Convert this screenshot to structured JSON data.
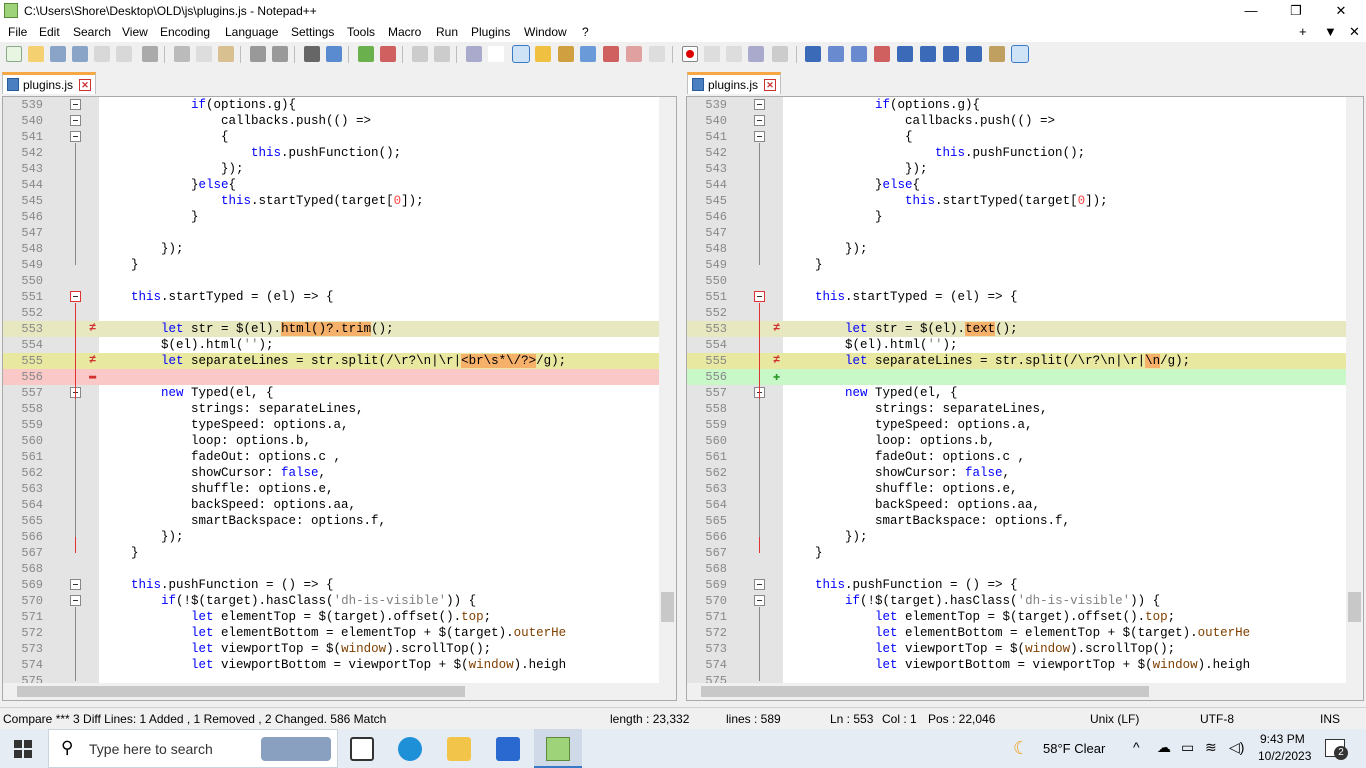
{
  "window": {
    "title": "C:\\Users\\Shore\\Desktop\\OLD\\js\\plugins.js - Notepad++"
  },
  "menu": [
    "File",
    "Edit",
    "Search",
    "View",
    "Encoding",
    "Language",
    "Settings",
    "Tools",
    "Macro",
    "Run",
    "Plugins",
    "Window",
    "?"
  ],
  "menu_right": [
    "+",
    "▼",
    "✕"
  ],
  "tabs": {
    "left": {
      "name": "plugins.js"
    },
    "right": {
      "name": "plugins.js"
    }
  },
  "left_lines": [
    {
      "n": "539",
      "t": "            if(options.g){"
    },
    {
      "n": "540",
      "t": "                callbacks.push(() =>"
    },
    {
      "n": "541",
      "t": "                {"
    },
    {
      "n": "542",
      "t": "                    this.pushFunction();"
    },
    {
      "n": "543",
      "t": "                });"
    },
    {
      "n": "544",
      "t": "            }else{"
    },
    {
      "n": "545",
      "t": "                this.startTyped(target[0]);"
    },
    {
      "n": "546",
      "t": "            }"
    },
    {
      "n": "547",
      "t": ""
    },
    {
      "n": "548",
      "t": "        });"
    },
    {
      "n": "549",
      "t": "    }"
    },
    {
      "n": "550",
      "t": ""
    },
    {
      "n": "551",
      "t": "    this.startTyped = (el) => {"
    },
    {
      "n": "552",
      "t": ""
    },
    {
      "n": "553",
      "t": "        let str = $(el).html()?.trim();"
    },
    {
      "n": "554",
      "t": "        $(el).html('');"
    },
    {
      "n": "555",
      "t": "        let separateLines = str.split(/\\r?\\n|\\r|<br\\s*\\/?>/g);"
    },
    {
      "n": "556",
      "t": ""
    },
    {
      "n": "557",
      "t": "        new Typed(el, {"
    },
    {
      "n": "558",
      "t": "            strings: separateLines,"
    },
    {
      "n": "559",
      "t": "            typeSpeed: options.a,"
    },
    {
      "n": "560",
      "t": "            loop: options.b,"
    },
    {
      "n": "561",
      "t": "            fadeOut: options.c ,"
    },
    {
      "n": "562",
      "t": "            showCursor: false,"
    },
    {
      "n": "563",
      "t": "            shuffle: options.e,"
    },
    {
      "n": "564",
      "t": "            backSpeed: options.aa,"
    },
    {
      "n": "565",
      "t": "            smartBackspace: options.f,"
    },
    {
      "n": "566",
      "t": "        });"
    },
    {
      "n": "567",
      "t": "    }"
    },
    {
      "n": "568",
      "t": ""
    },
    {
      "n": "569",
      "t": "    this.pushFunction = () => {"
    },
    {
      "n": "570",
      "t": "        if(!$(target).hasClass('dh-is-visible')) {"
    },
    {
      "n": "571",
      "t": "            let elementTop = $(target).offset().top;"
    },
    {
      "n": "572",
      "t": "            let elementBottom = elementTop + $(target).outerHe"
    },
    {
      "n": "573",
      "t": "            let viewportTop = $(window).scrollTop();"
    },
    {
      "n": "574",
      "t": "            let viewportBottom = viewportTop + $(window).heigh"
    },
    {
      "n": "575",
      "t": ""
    }
  ],
  "right_lines": [
    {
      "n": "539",
      "t": "            if(options.g){"
    },
    {
      "n": "540",
      "t": "                callbacks.push(() =>"
    },
    {
      "n": "541",
      "t": "                {"
    },
    {
      "n": "542",
      "t": "                    this.pushFunction();"
    },
    {
      "n": "543",
      "t": "                });"
    },
    {
      "n": "544",
      "t": "            }else{"
    },
    {
      "n": "545",
      "t": "                this.startTyped(target[0]);"
    },
    {
      "n": "546",
      "t": "            }"
    },
    {
      "n": "547",
      "t": ""
    },
    {
      "n": "548",
      "t": "        });"
    },
    {
      "n": "549",
      "t": "    }"
    },
    {
      "n": "550",
      "t": ""
    },
    {
      "n": "551",
      "t": "    this.startTyped = (el) => {"
    },
    {
      "n": "552",
      "t": ""
    },
    {
      "n": "553",
      "t": "        let str = $(el).text();"
    },
    {
      "n": "554",
      "t": "        $(el).html('');"
    },
    {
      "n": "555",
      "t": "        let separateLines = str.split(/\\r?\\n|\\r|\\n/g);"
    },
    {
      "n": "556",
      "t": ""
    },
    {
      "n": "557",
      "t": "        new Typed(el, {"
    },
    {
      "n": "558",
      "t": "            strings: separateLines,"
    },
    {
      "n": "559",
      "t": "            typeSpeed: options.a,"
    },
    {
      "n": "560",
      "t": "            loop: options.b,"
    },
    {
      "n": "561",
      "t": "            fadeOut: options.c ,"
    },
    {
      "n": "562",
      "t": "            showCursor: false,"
    },
    {
      "n": "563",
      "t": "            shuffle: options.e,"
    },
    {
      "n": "564",
      "t": "            backSpeed: options.aa,"
    },
    {
      "n": "565",
      "t": "            smartBackspace: options.f,"
    },
    {
      "n": "566",
      "t": "        });"
    },
    {
      "n": "567",
      "t": "    }"
    },
    {
      "n": "568",
      "t": ""
    },
    {
      "n": "569",
      "t": "    this.pushFunction = () => {"
    },
    {
      "n": "570",
      "t": "        if(!$(target).hasClass('dh-is-visible')) {"
    },
    {
      "n": "571",
      "t": "            let elementTop = $(target).offset().top;"
    },
    {
      "n": "572",
      "t": "            let elementBottom = elementTop + $(target).outerHe"
    },
    {
      "n": "573",
      "t": "            let viewportTop = $(window).scrollTop();"
    },
    {
      "n": "574",
      "t": "            let viewportBottom = viewportTop + $(window).heigh"
    },
    {
      "n": "575",
      "t": ""
    }
  ],
  "status": {
    "compare": "Compare *** 3 Diff Lines:  1 Added , 1 Removed , 2 Changed.  586 Match",
    "length": "length : 23,332",
    "lines": "lines : 589",
    "ln": "Ln : 553",
    "col": "Col : 1",
    "pos": "Pos : 22,046",
    "eol": "Unix (LF)",
    "enc": "UTF-8",
    "ins": "INS"
  },
  "taskbar": {
    "search_placeholder": "Type here to search",
    "weather": "58°F  Clear",
    "time": "9:43 PM",
    "date": "10/2/2023",
    "notifications": "2"
  }
}
